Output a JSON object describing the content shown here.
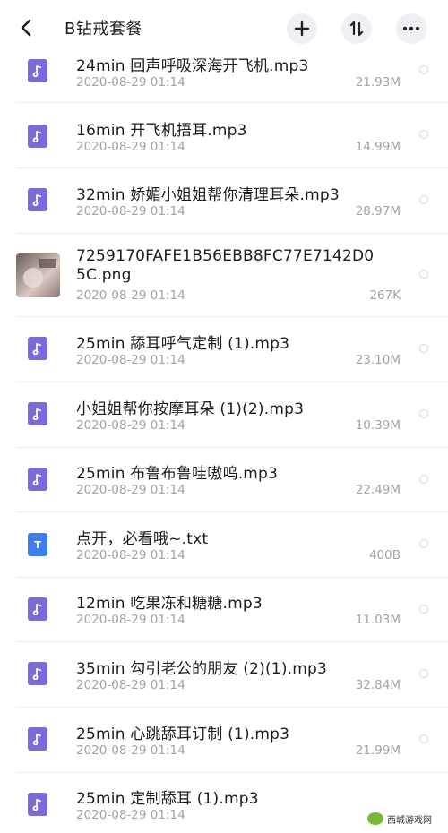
{
  "header": {
    "title": "B钻戒套餐",
    "back_icon": "chevron-left-icon",
    "add_icon": "plus-icon",
    "sort_icon": "sort-icon",
    "more_icon": "more-horizontal-icon"
  },
  "files": [
    {
      "name": "24min 回声呼吸深海开飞机.mp3",
      "date": "2020-08-29 01:14",
      "size": "21.93M",
      "type": "audio"
    },
    {
      "name": "16min 开飞机捂耳.mp3",
      "date": "2020-08-29 01:14",
      "size": "14.99M",
      "type": "audio"
    },
    {
      "name": "32min 娇媚小姐姐帮你清理耳朵.mp3",
      "date": "2020-08-29 01:14",
      "size": "28.97M",
      "type": "audio"
    },
    {
      "name": "7259170FAFE1B56EBB8FC77E7142D0",
      "name2": "5C.png",
      "date": "2020-08-29 01:14",
      "size": "267K",
      "type": "image"
    },
    {
      "name": "25min 舔耳呼气定制 (1).mp3",
      "date": "2020-08-29 01:14",
      "size": "23.10M",
      "type": "audio"
    },
    {
      "name": "小姐姐帮你按摩耳朵 (1)(2).mp3",
      "date": "2020-08-29 01:14",
      "size": "10.39M",
      "type": "audio"
    },
    {
      "name": "25min 布鲁布鲁哇嗷呜.mp3",
      "date": "2020-08-29 01:14",
      "size": "22.49M",
      "type": "audio"
    },
    {
      "name": "点开，必看哦~.txt",
      "date": "2020-08-29 01:14",
      "size": "400B",
      "type": "text"
    },
    {
      "name": "12min 吃果冻和糖糖.mp3",
      "date": "2020-08-29 01:14",
      "size": "11.03M",
      "type": "audio"
    },
    {
      "name": "35min 勾引老公的朋友 (2)(1).mp3",
      "date": "2020-08-29 01:14",
      "size": "32.84M",
      "type": "audio"
    },
    {
      "name": "25min 心跳舔耳订制 (1).mp3",
      "date": "2020-08-29 01:14",
      "size": "21.99M",
      "type": "audio"
    },
    {
      "name": "25min 定制舔耳 (1).mp3",
      "date": "2020-08-29 01:14",
      "size": "",
      "type": "audio"
    }
  ],
  "icons": {
    "audio": "music-note-icon",
    "text": "text-file-icon",
    "image": "image-thumbnail"
  },
  "watermark": {
    "text": "西城游戏网"
  }
}
